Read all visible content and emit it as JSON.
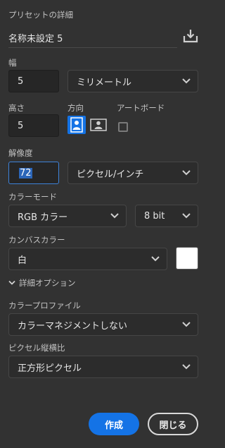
{
  "preset": {
    "section_title": "プリセットの詳細",
    "name_value": "名称未設定 5"
  },
  "width": {
    "label": "幅",
    "value": "5",
    "unit": "ミリメートル"
  },
  "height": {
    "label": "高さ",
    "value": "5"
  },
  "orientation": {
    "label": "方向"
  },
  "artboard": {
    "label": "アートボード"
  },
  "resolution": {
    "label": "解像度",
    "value": "72",
    "unit": "ピクセル/インチ"
  },
  "color_mode": {
    "label": "カラーモード",
    "mode": "RGB カラー",
    "depth": "8 bit"
  },
  "canvas_color": {
    "label": "カンバスカラー",
    "value": "白",
    "swatch": "#ffffff"
  },
  "advanced": {
    "label": "詳細オプション"
  },
  "color_profile": {
    "label": "カラープロファイル",
    "value": "カラーマネジメントしない"
  },
  "pixel_aspect": {
    "label": "ピクセル縦横比",
    "value": "正方形ピクセル"
  },
  "actions": {
    "create": "作成",
    "close": "閉じる"
  },
  "colors": {
    "accent": "#1473e6",
    "background": "#323232"
  }
}
